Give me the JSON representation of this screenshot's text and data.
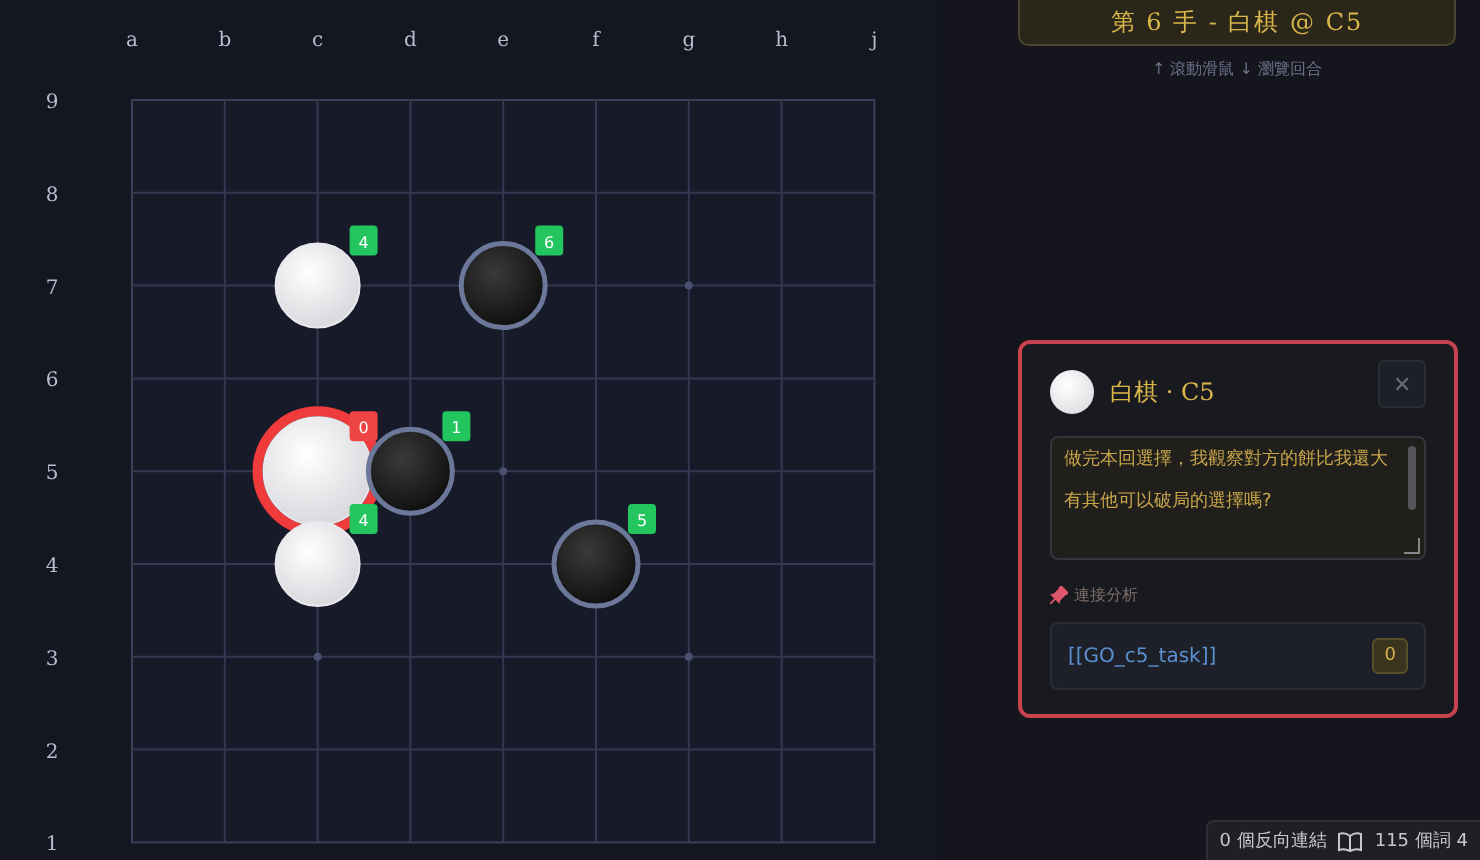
{
  "board": {
    "columns": [
      "a",
      "b",
      "c",
      "d",
      "e",
      "f",
      "g",
      "h",
      "j"
    ],
    "rows": [
      {
        "label": "9",
        "points": [
          {
            "kind": "empty"
          },
          {
            "kind": "empty"
          },
          {
            "kind": "empty"
          },
          {
            "kind": "empty"
          },
          {
            "kind": "empty"
          },
          {
            "kind": "empty"
          },
          {
            "kind": "empty"
          },
          {
            "kind": "empty"
          },
          {
            "kind": "empty"
          }
        ]
      },
      {
        "label": "8",
        "points": [
          {
            "kind": "empty"
          },
          {
            "kind": "empty"
          },
          {
            "kind": "empty"
          },
          {
            "kind": "empty"
          },
          {
            "kind": "empty"
          },
          {
            "kind": "empty"
          },
          {
            "kind": "empty"
          },
          {
            "kind": "empty"
          },
          {
            "kind": "empty"
          }
        ]
      },
      {
        "label": "7",
        "points": [
          {
            "kind": "empty"
          },
          {
            "kind": "empty"
          },
          {
            "kind": "white",
            "badge": "4",
            "color": "#22c55e",
            "selected": false
          },
          {
            "kind": "empty"
          },
          {
            "kind": "black",
            "badge": "6",
            "color": "#22c55e",
            "selected": false
          },
          {
            "kind": "empty"
          },
          {
            "kind": "empty"
          },
          {
            "kind": "empty"
          },
          {
            "kind": "empty"
          }
        ]
      },
      {
        "label": "6",
        "points": [
          {
            "kind": "empty"
          },
          {
            "kind": "empty"
          },
          {
            "kind": "empty"
          },
          {
            "kind": "empty"
          },
          {
            "kind": "empty"
          },
          {
            "kind": "empty"
          },
          {
            "kind": "empty"
          },
          {
            "kind": "empty"
          },
          {
            "kind": "empty"
          }
        ]
      },
      {
        "label": "5",
        "points": [
          {
            "kind": "empty"
          },
          {
            "kind": "empty"
          },
          {
            "kind": "white",
            "badge": "0",
            "color": "#ef4444",
            "selected": true
          },
          {
            "kind": "black",
            "badge": "1",
            "color": "#22c55e",
            "selected": false
          },
          {
            "kind": "empty"
          },
          {
            "kind": "empty"
          },
          {
            "kind": "empty"
          },
          {
            "kind": "empty"
          },
          {
            "kind": "empty"
          }
        ]
      },
      {
        "label": "4",
        "points": [
          {
            "kind": "empty"
          },
          {
            "kind": "empty"
          },
          {
            "kind": "white",
            "badge": "4",
            "color": "#22c55e",
            "selected": false
          },
          {
            "kind": "empty"
          },
          {
            "kind": "empty"
          },
          {
            "kind": "black",
            "badge": "5",
            "color": "#22c55e",
            "selected": false
          },
          {
            "kind": "empty"
          },
          {
            "kind": "empty"
          },
          {
            "kind": "empty"
          }
        ]
      },
      {
        "label": "3",
        "points": [
          {
            "kind": "empty"
          },
          {
            "kind": "empty"
          },
          {
            "kind": "empty"
          },
          {
            "kind": "empty"
          },
          {
            "kind": "empty"
          },
          {
            "kind": "empty"
          },
          {
            "kind": "empty"
          },
          {
            "kind": "empty"
          },
          {
            "kind": "empty"
          }
        ]
      },
      {
        "label": "2",
        "points": [
          {
            "kind": "empty"
          },
          {
            "kind": "empty"
          },
          {
            "kind": "empty"
          },
          {
            "kind": "empty"
          },
          {
            "kind": "empty"
          },
          {
            "kind": "empty"
          },
          {
            "kind": "empty"
          },
          {
            "kind": "empty"
          },
          {
            "kind": "empty"
          }
        ]
      },
      {
        "label": "1",
        "points": [
          {
            "kind": "empty"
          },
          {
            "kind": "empty"
          },
          {
            "kind": "empty"
          },
          {
            "kind": "empty"
          },
          {
            "kind": "empty"
          },
          {
            "kind": "empty"
          },
          {
            "kind": "empty"
          },
          {
            "kind": "empty"
          },
          {
            "kind": "empty"
          }
        ]
      }
    ]
  },
  "move_header": "第 6 手 - 白棋 @ C5",
  "hint": "↑ 滾動滑鼠 ↓ 瀏覽回合",
  "detail": {
    "kind": "white",
    "title": "白棋 · C5",
    "close": "✕",
    "note": [
      "做完本回選擇，我觀察對方的餅比我還大",
      "有其他可以破局的選擇嗎?"
    ],
    "links_label": "連接分析",
    "link": {
      "text": "[[GO_c5_task]]",
      "count": "0"
    }
  },
  "status_bar": {
    "backlinks": "0 個反向連結",
    "words": "115 個詞 4"
  }
}
